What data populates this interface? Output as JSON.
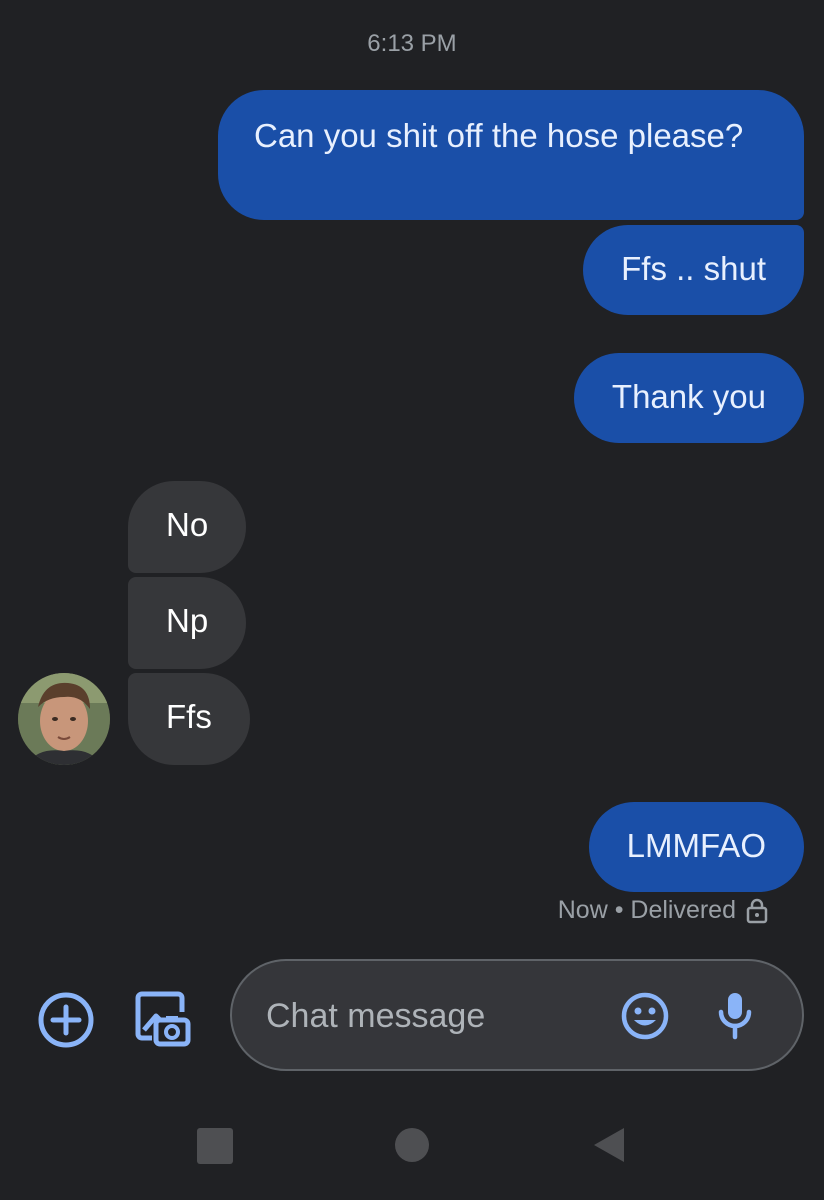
{
  "conversation": {
    "timestamp": "6:13 PM",
    "messages": [
      {
        "direction": "outgoing",
        "text": "Can you shit off the hose please?"
      },
      {
        "direction": "outgoing",
        "text": "Ffs .. shut"
      },
      {
        "direction": "outgoing",
        "text": "Thank you"
      },
      {
        "direction": "incoming",
        "text": "No"
      },
      {
        "direction": "incoming",
        "text": "Np"
      },
      {
        "direction": "incoming",
        "text": "Ffs"
      },
      {
        "direction": "outgoing",
        "text": "LMMFAO"
      }
    ],
    "delivery_status": "Now • Delivered"
  },
  "composer": {
    "placeholder": "Chat message"
  },
  "icons": {
    "add": "add-circle-icon",
    "gallery": "gallery-camera-icon",
    "emoji": "emoji-icon",
    "mic": "microphone-icon",
    "lock": "lock-icon",
    "nav_recents": "square-icon",
    "nav_home": "circle-icon",
    "nav_back": "triangle-back-icon"
  },
  "colors": {
    "background": "#202124",
    "outgoing_bubble": "#1a4fa8",
    "incoming_bubble": "#36373a",
    "accent": "#8ab4f8"
  }
}
